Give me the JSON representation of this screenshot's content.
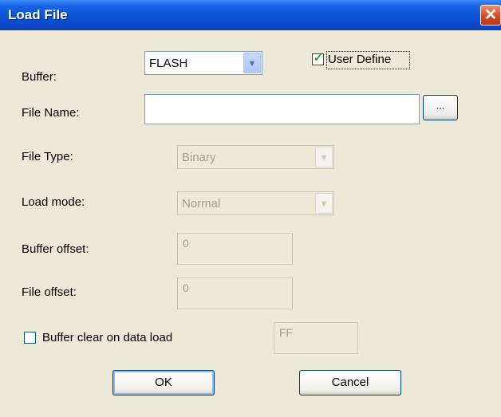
{
  "window": {
    "title": "Load File",
    "close_glyph": "✕"
  },
  "buffer": {
    "label": "Buffer:",
    "value": "FLASH"
  },
  "user_define": {
    "label": "User Define",
    "checked": true
  },
  "file_name": {
    "label": "File Name:",
    "value": "",
    "browse_label": "..."
  },
  "file_type": {
    "label": "File Type:",
    "value": "Binary"
  },
  "load_mode": {
    "label": "Load mode:",
    "value": "Normal"
  },
  "buffer_offset": {
    "label": "Buffer offset:",
    "value": "0"
  },
  "file_offset": {
    "label": "File offset:",
    "value": "0"
  },
  "buffer_clear": {
    "label": "Buffer clear on data load",
    "checked": false,
    "fill_value": "FF"
  },
  "buttons": {
    "ok": "OK",
    "cancel": "Cancel"
  },
  "icons": {
    "dropdown": "chevron-down-icon",
    "check": "check-icon",
    "close": "close-icon"
  }
}
